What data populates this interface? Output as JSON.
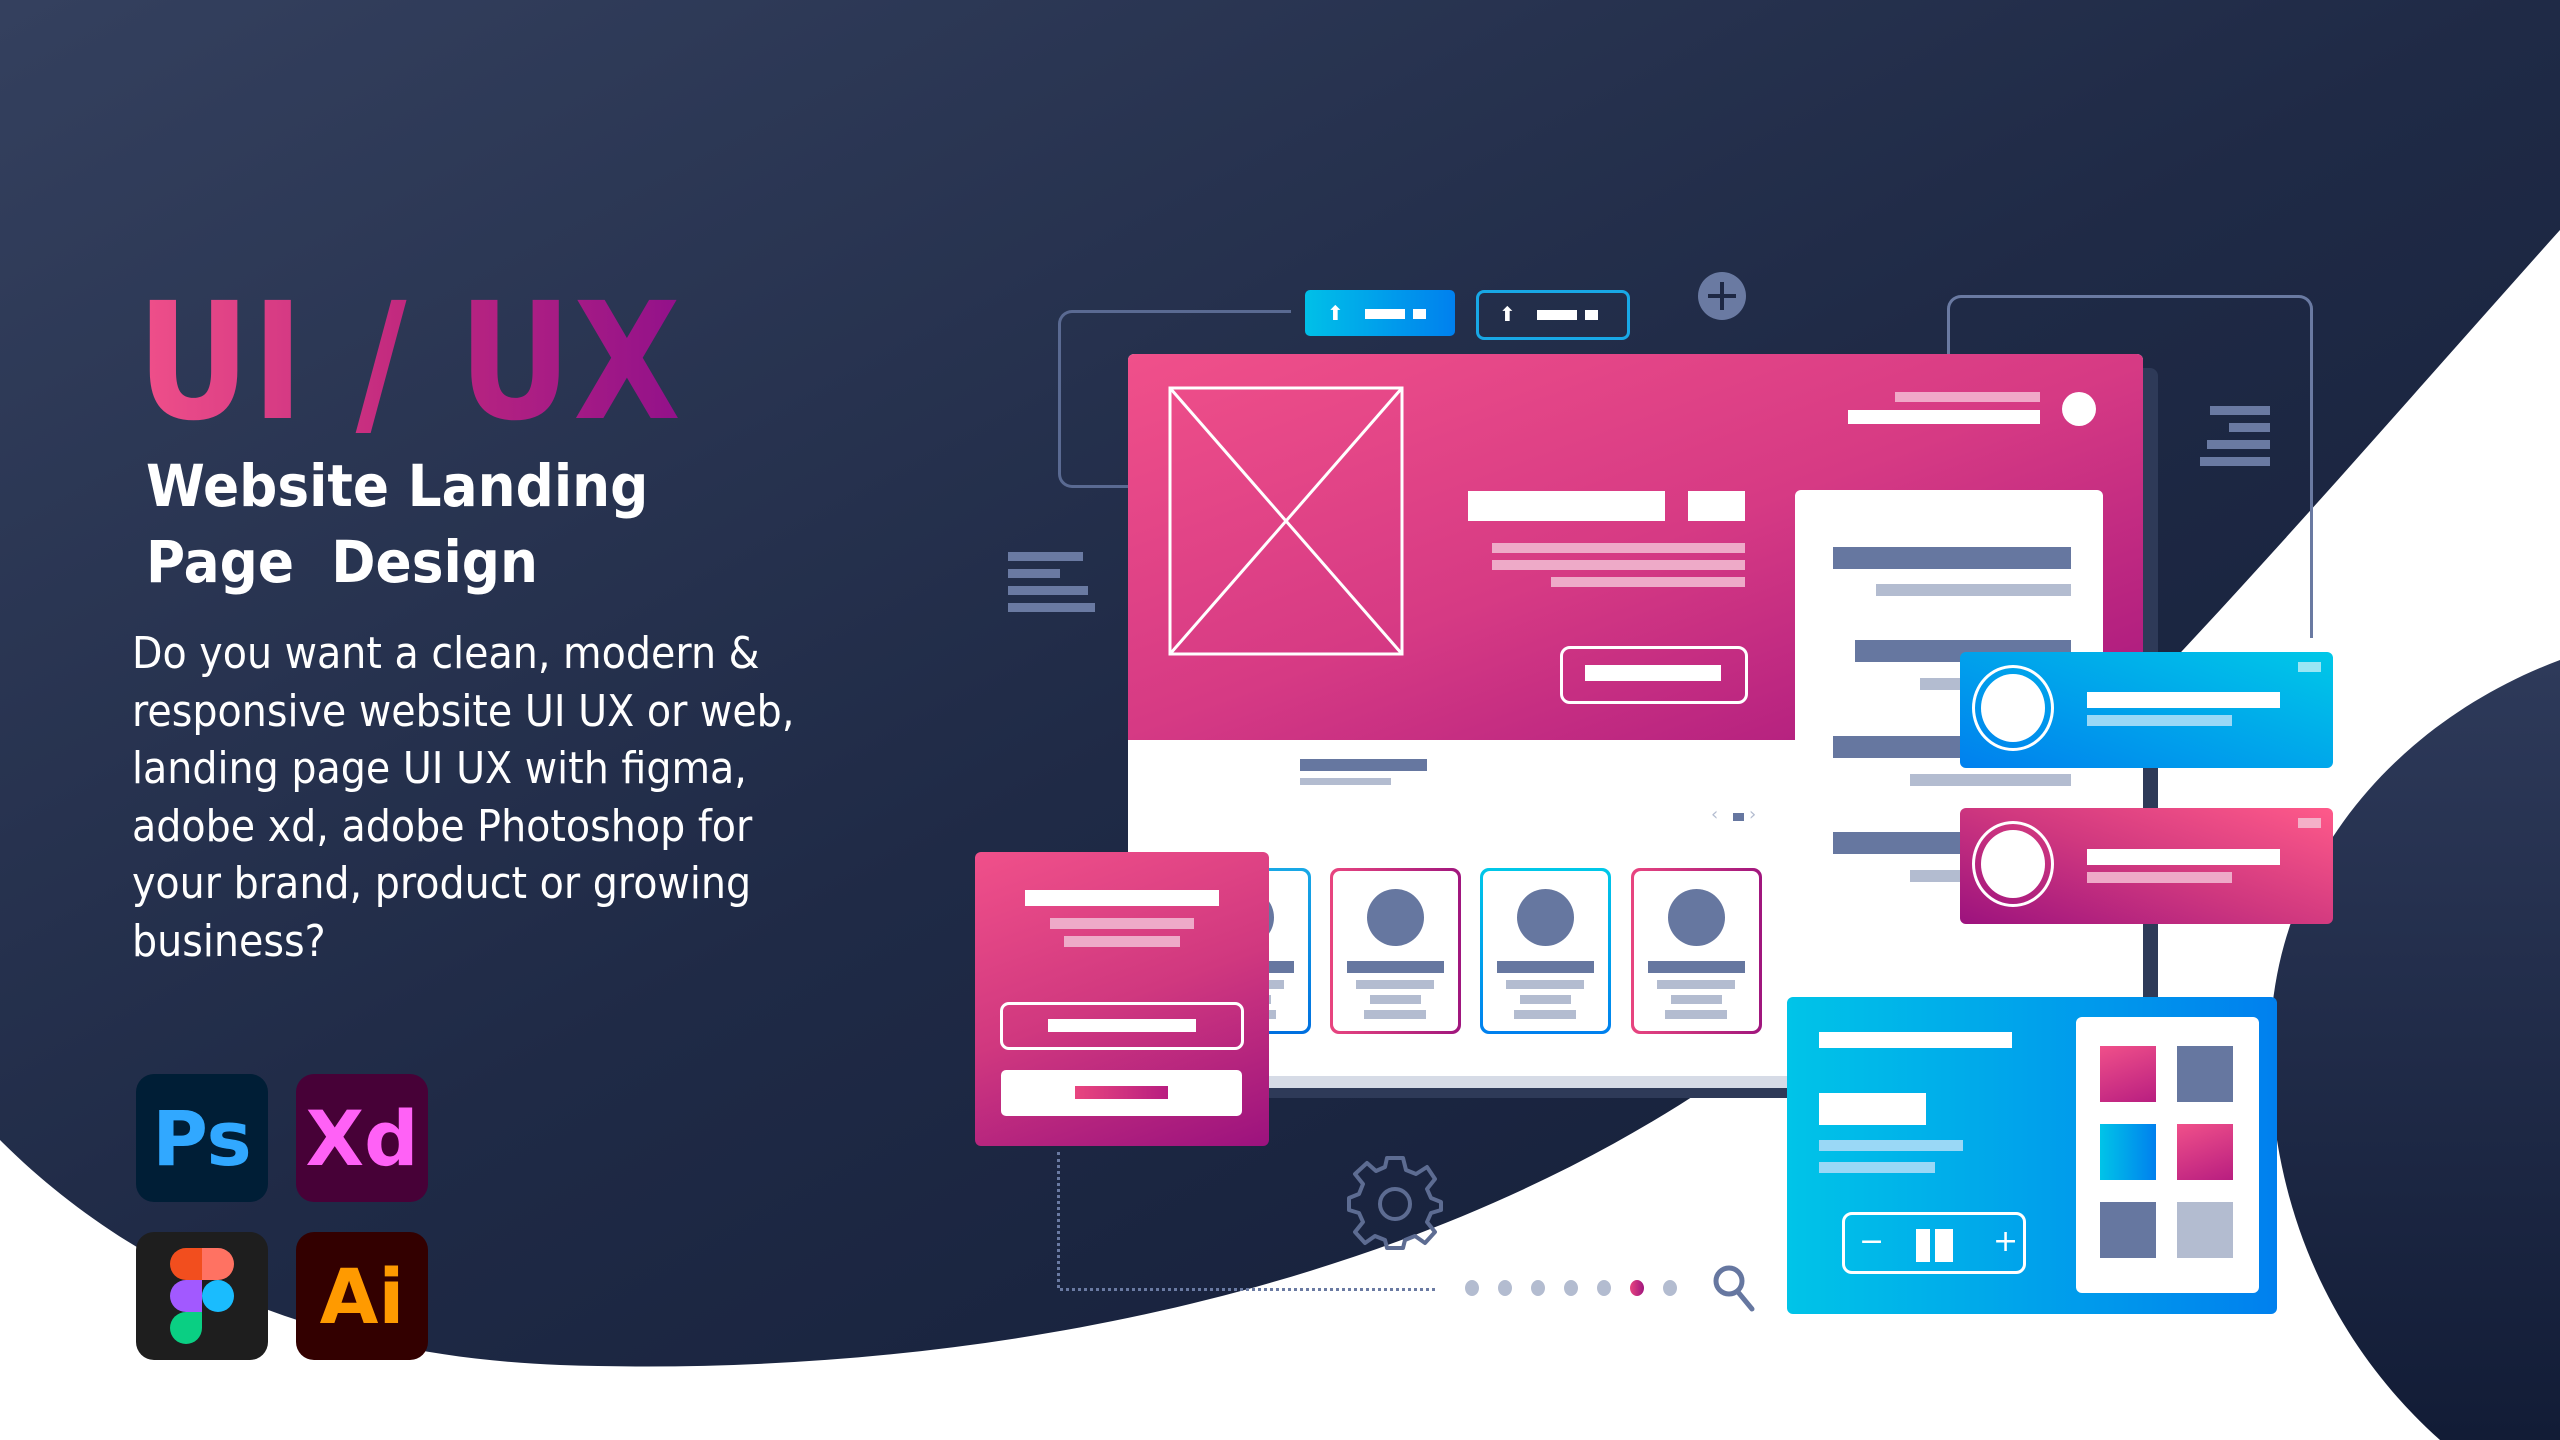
{
  "headline": {
    "title": "UI / UX",
    "subtitle_line1": "Website Landing",
    "subtitle_line2": "Page  Design"
  },
  "description": {
    "lines": [
      "Do you want a clean, modern &",
      "responsive website UI UX or web,",
      "landing page UI UX with figma,",
      "adobe xd, adobe Photoshop for",
      "your brand, product or growing",
      "business?"
    ]
  },
  "apps": [
    {
      "name": "Photoshop",
      "label": "Ps",
      "bg": "#001e36",
      "fg": "#31a8ff"
    },
    {
      "name": "Adobe XD",
      "label": "Xd",
      "bg": "#470137",
      "fg": "#ff61f6"
    },
    {
      "name": "Figma",
      "label": "",
      "bg": "#1e1e1e",
      "fg": ""
    },
    {
      "name": "Illustrator",
      "label": "Ai",
      "bg": "#330000",
      "fg": "#ff9a00"
    }
  ],
  "illustration": {
    "tabs": [
      "active-tab",
      "inactive-tab"
    ],
    "stepper": {
      "minus": "−",
      "plus": "+"
    },
    "pagination": {
      "total_dots": 7,
      "active_index": 5
    },
    "slider_arrows": {
      "prev": "‹",
      "next": "›"
    }
  },
  "colors": {
    "background_dark": "#1c2640",
    "pink": "#e8457f",
    "magenta": "#a0167e",
    "blue": "#0088ee",
    "cyan": "#00c8e8",
    "slate": "#6677a0",
    "slate_light": "#b3bcd0"
  }
}
